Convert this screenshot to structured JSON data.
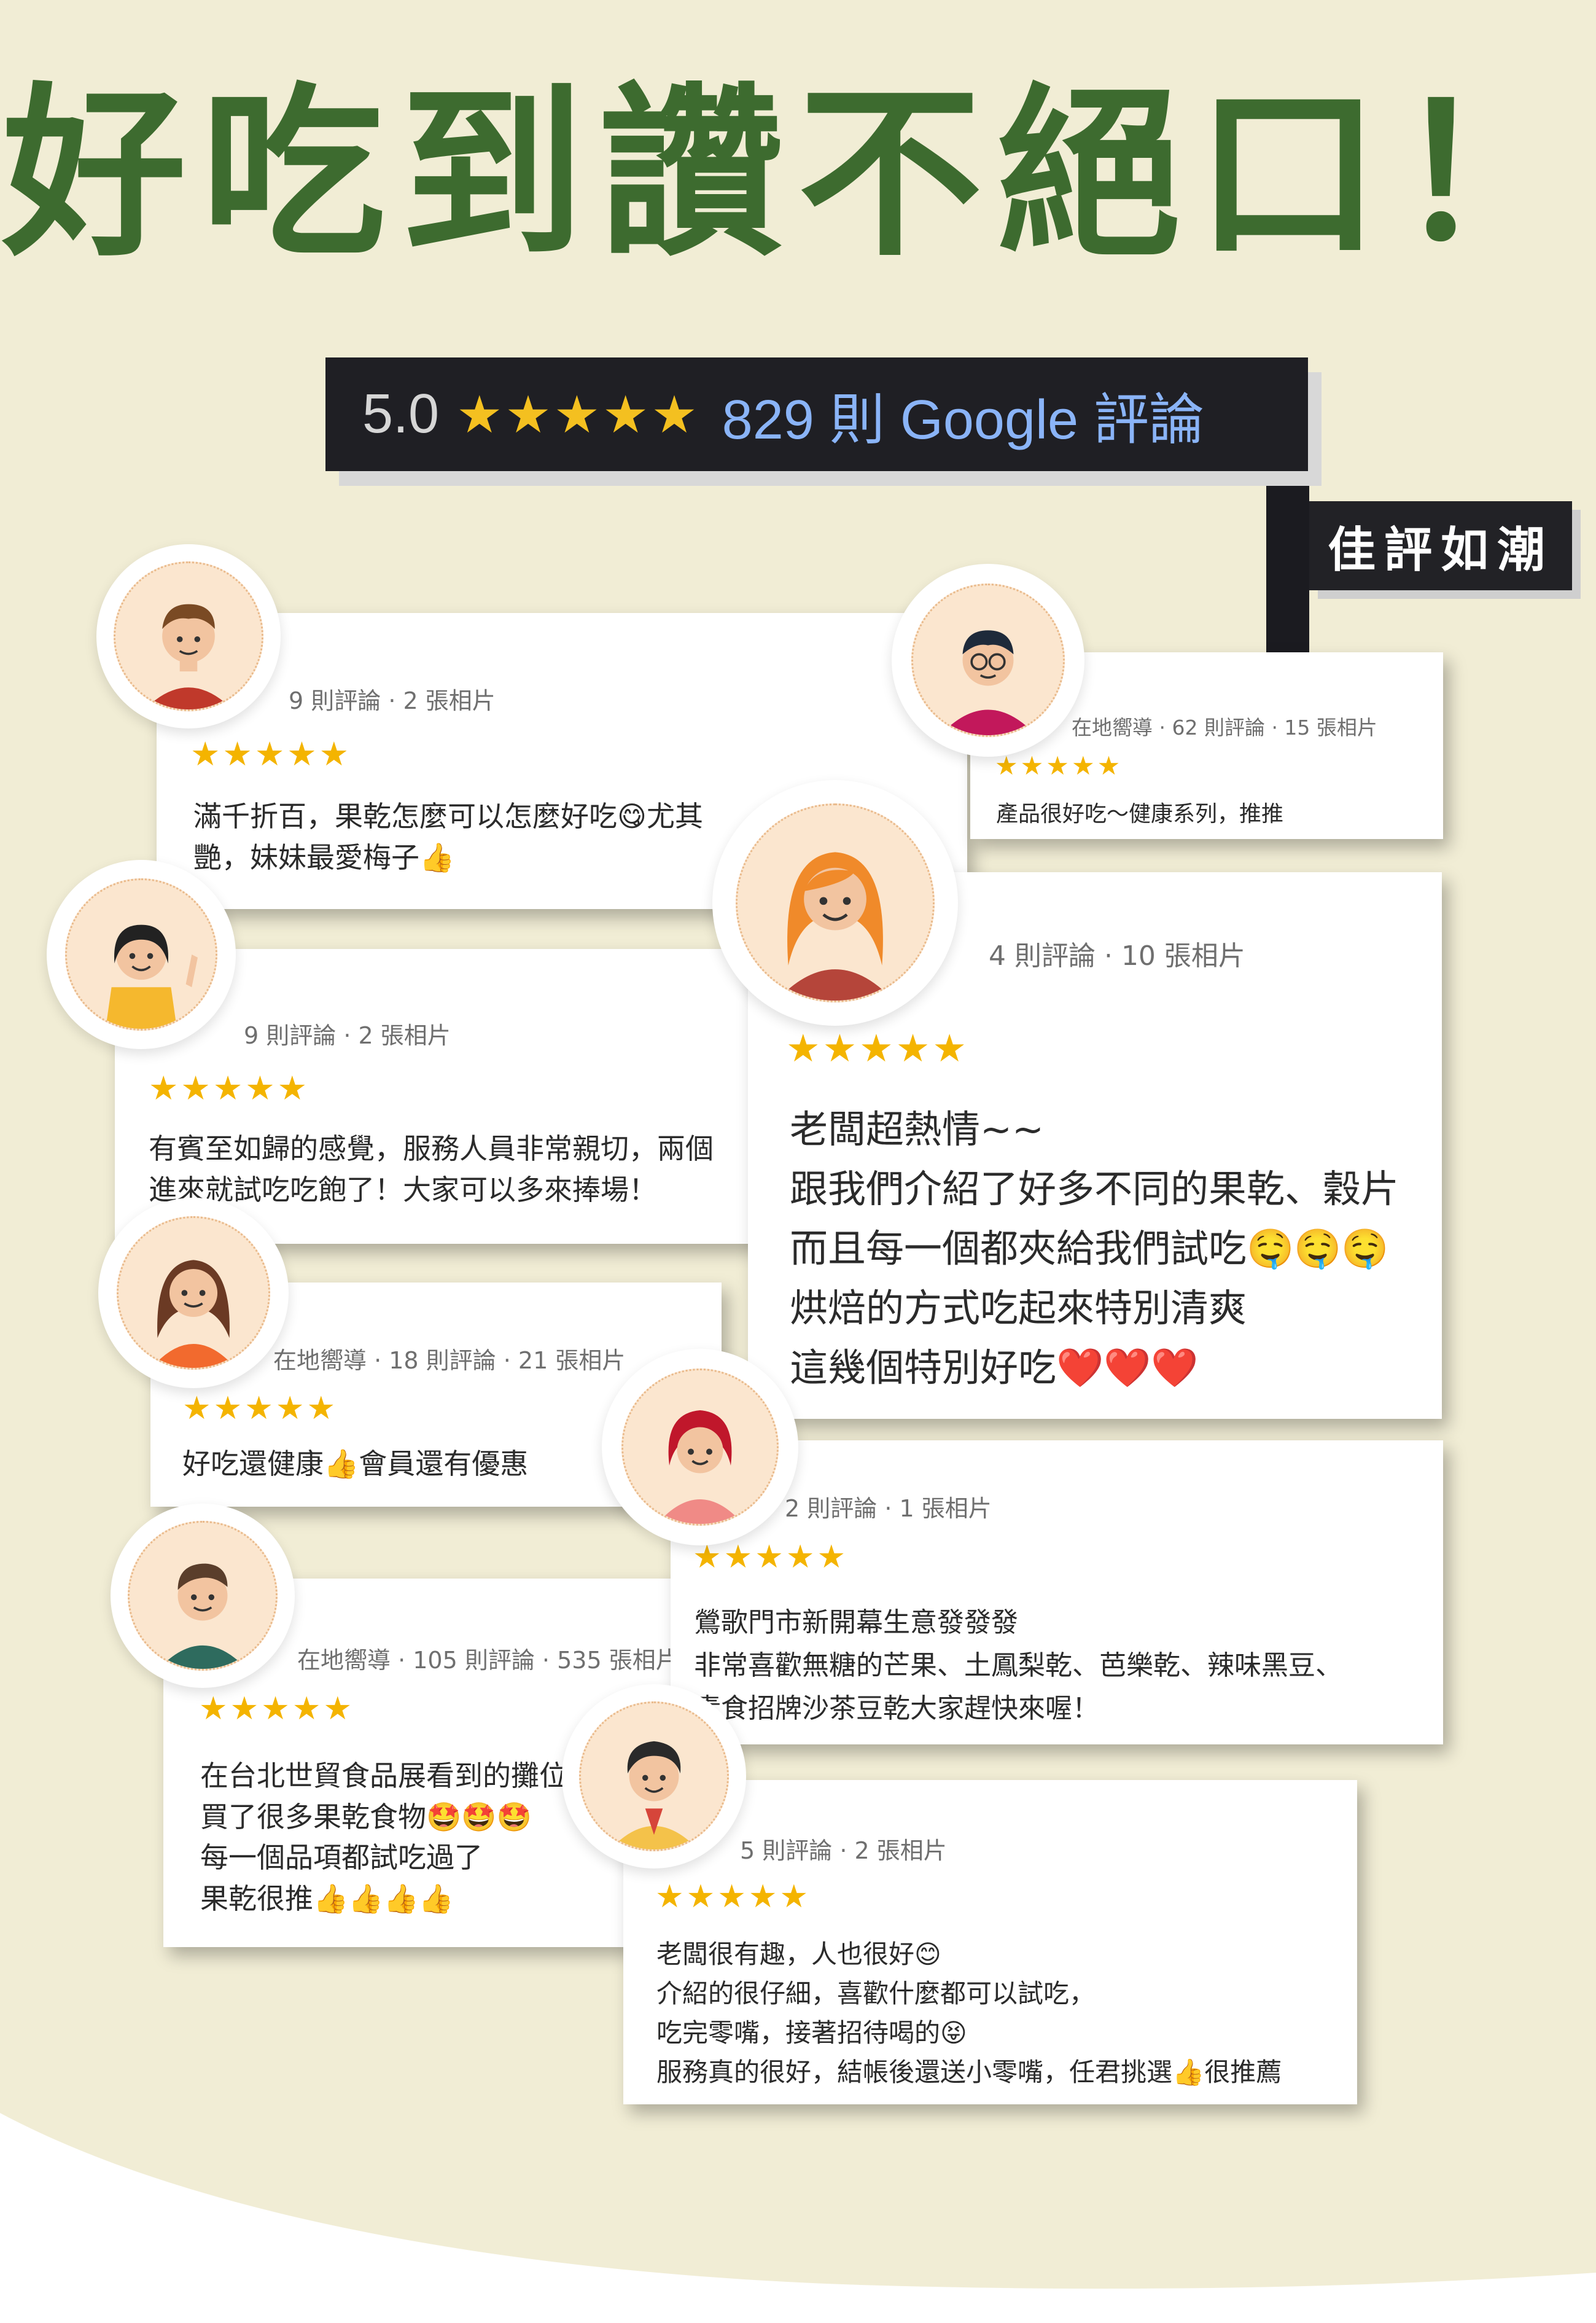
{
  "headline": "好吃到讚不絕口！",
  "rating_bar": {
    "score": "5.0",
    "stars": "★★★★★",
    "count_text": "829 則 Google 評論"
  },
  "tag": "佳評如潮",
  "reviews": [
    {
      "meta": "9 則評論 · 2 張相片",
      "stars": "★★★★★",
      "lines": [
        "滿千折百，果乾怎麼可以怎麼好吃😋尤其",
        "艷，妹妹最愛梅子👍"
      ],
      "avatar": "man-brown-hair-avatar-icon"
    },
    {
      "meta": "在地嚮導 · 62 則評論 · 15 張相片",
      "stars": "★★★★★",
      "lines": [
        "產品很好吃～健康系列，推推"
      ],
      "avatar": "man-glasses-avatar-icon"
    },
    {
      "meta": "4 則評論 · 10 張相片",
      "stars": "★★★★★",
      "lines": [
        "老闆超熱情~~",
        "跟我們介紹了好多不同的果乾、穀片",
        "而且每一個都夾給我們試吃🤤🤤🤤",
        "烘焙的方式吃起來特別清爽",
        "這幾個特別好吃❤️❤️❤️"
      ],
      "avatar": "woman-orange-hair-avatar-icon"
    },
    {
      "meta": "9 則評論 · 2 張相片",
      "stars": "★★★★★",
      "lines": [
        "有賓至如歸的感覺，服務人員非常親切，兩個",
        "進來就試吃吃飽了！大家可以多來捧場！"
      ],
      "avatar": "woman-waving-avatar-icon"
    },
    {
      "meta": "在地嚮導 · 18 則評論 · 21 張相片",
      "stars": "★★★★★",
      "lines": [
        "好吃還健康👍會員還有優惠"
      ],
      "avatar": "woman-long-hair-avatar-icon"
    },
    {
      "meta": "2 則評論 · 1 張相片",
      "stars": "★★★★★",
      "lines": [
        "鶯歌門市新開幕生意發發發",
        "非常喜歡無糖的芒果、土鳳梨乾、芭樂乾、辣味黑豆、",
        "素食招牌沙茶豆乾大家趕快來喔！"
      ],
      "avatar": "woman-red-hair-avatar-icon"
    },
    {
      "meta": "在地嚮導 · 105 則評論 · 535 張相片",
      "stars": "★★★★★",
      "lines": [
        "在台北世貿食品展看到的攤位",
        "買了很多果乾食物🤩🤩🤩",
        "每一個品項都試吃過了",
        "果乾很推👍👍👍👍"
      ],
      "avatar": "man-green-shirt-avatar-icon"
    },
    {
      "meta": "5 則評論 · 2 張相片",
      "stars": "★★★★★",
      "lines": [
        "老闆很有趣，人也很好😊",
        "介紹的很仔細，喜歡什麼都可以試吃，",
        "吃完零嘴，接著招待喝的😝",
        "服務真的很好，結帳後還送小零嘴，任君挑選👍很推薦"
      ],
      "avatar": "man-curly-hair-avatar-icon"
    }
  ]
}
